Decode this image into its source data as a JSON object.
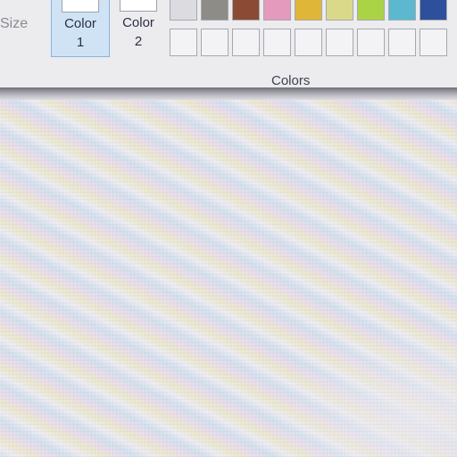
{
  "ribbon": {
    "size_label": "Size",
    "color1": {
      "label_line1": "Color",
      "label_line2": "1",
      "swatch_color": "#ffffff"
    },
    "color2": {
      "label_line1": "Color",
      "label_line2": "2",
      "swatch_color": "#ffffff"
    },
    "palette": {
      "group_label": "Colors",
      "top_row": [
        "#dcdce0",
        "#8e8c86",
        "#8b4a33",
        "#e49abd",
        "#e0b638",
        "#dad98a",
        "#aad346",
        "#5cb8cf",
        "#2e4f9b"
      ],
      "bottom_row": [
        "#f3f3f5",
        "#f3f3f5",
        "#f3f3f5",
        "#f3f3f5",
        "#f3f3f5",
        "#f3f3f5",
        "#f3f3f5",
        "#f3f3f5",
        "#f3f3f5"
      ]
    }
  },
  "canvas": {
    "background": "#ffffff"
  }
}
